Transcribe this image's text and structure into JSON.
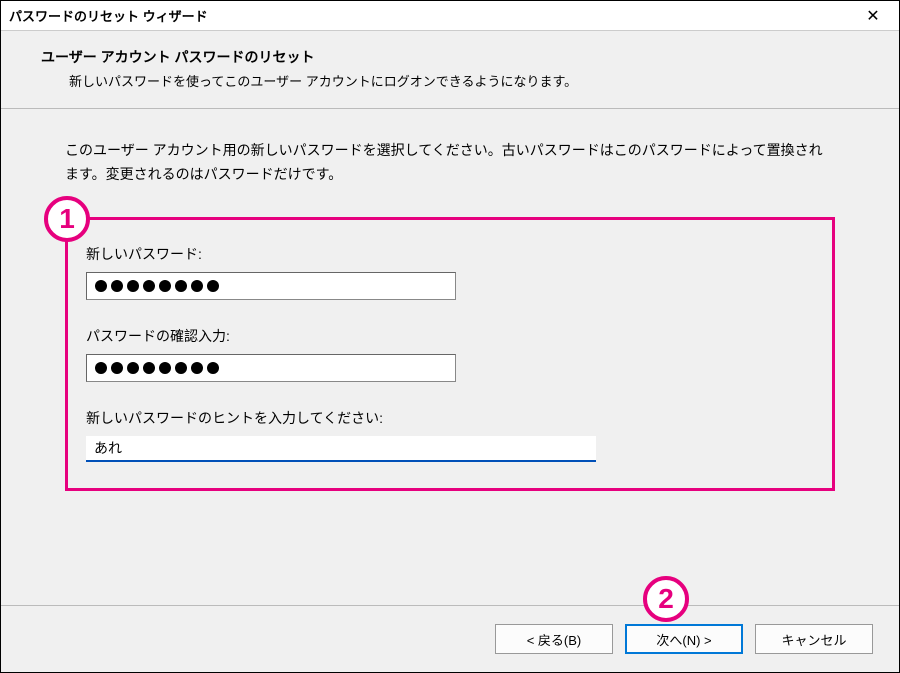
{
  "titlebar": {
    "title": "パスワードのリセット ウィザード"
  },
  "header": {
    "title": "ユーザー アカウント パスワードのリセット",
    "subtitle": "新しいパスワードを使ってこのユーザー アカウントにログオンできるようになります。"
  },
  "content": {
    "instruction": "このユーザー アカウント用の新しいパスワードを選択してください。古いパスワードはこのパスワードによって置換されます。変更されるのはパスワードだけです。",
    "new_password_label": "新しいパスワード:",
    "new_password_dots": 8,
    "confirm_password_label": "パスワードの確認入力:",
    "confirm_password_dots": 8,
    "hint_label": "新しいパスワードのヒントを入力してください:",
    "hint_value": "あれ"
  },
  "callouts": {
    "one": "1",
    "two": "2"
  },
  "footer": {
    "back": "< 戻る(B)",
    "next": "次へ(N) >",
    "cancel": "キャンセル"
  }
}
